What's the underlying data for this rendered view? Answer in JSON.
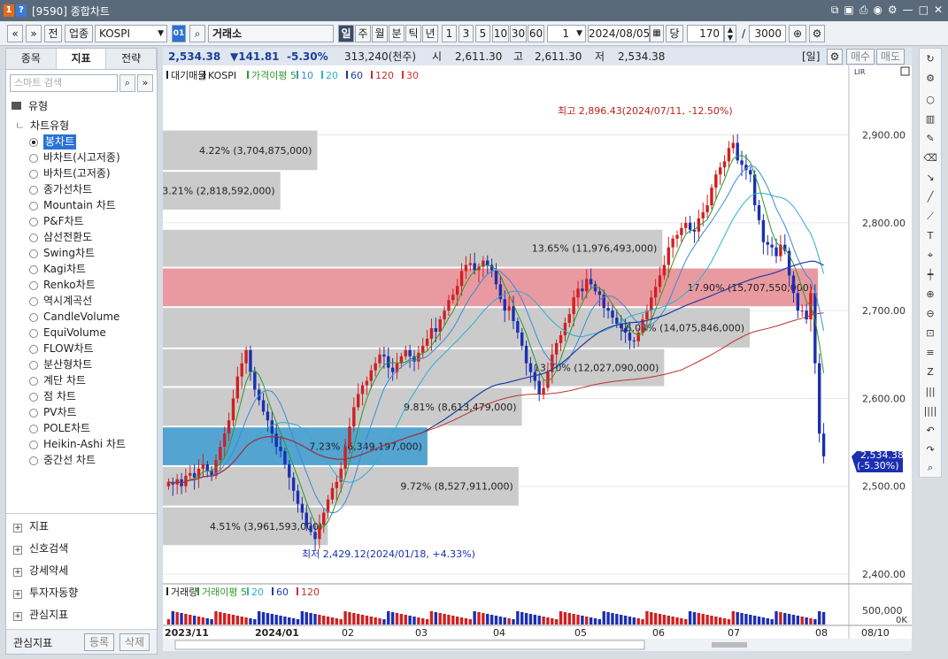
{
  "window": {
    "badge1": "1",
    "badge2": "?",
    "title": "[9590] 종합차트"
  },
  "toolbar": {
    "nav_prev": "«",
    "nav_down": "»",
    "jeon": "전",
    "category": "업종",
    "code": "KOSPI",
    "code_btn": "01",
    "market": "거래소",
    "periods": [
      "일",
      "주",
      "월",
      "분",
      "틱",
      "년"
    ],
    "intervals": [
      "1",
      "3",
      "5",
      "10",
      "30",
      "60"
    ],
    "count": "1",
    "date": "2024/08/05",
    "unit": "당",
    "bars": "170",
    "slash": "/",
    "max": "3000"
  },
  "left_panel": {
    "tabs": [
      "종목",
      "지표",
      "전략"
    ],
    "search_placeholder": "스마트 검색",
    "group": "유형",
    "subgroup": "차트유형",
    "chart_types": [
      "봉차트",
      "바차트(시고저종)",
      "바차트(고저종)",
      "종가선차트",
      "Mountain 차트",
      "P&F차트",
      "삼선전환도",
      "Swing차트",
      "Kagi차트",
      "Renko차트",
      "역시계곡선",
      "CandleVolume",
      "EquiVolume",
      "FLOW차트",
      "분산형차트",
      "계단 차트",
      "점 차트",
      "PV차트",
      "POLE차트",
      "Heikin-Ashi 차트",
      "중간선 차트"
    ],
    "bottom_groups": [
      "지표",
      "신호검색",
      "강세약세",
      "투자자동향",
      "관심지표"
    ],
    "footer": {
      "label": "관심지표",
      "register": "등록",
      "delete": "삭제"
    }
  },
  "price_bar": {
    "last": "2,534.38",
    "change": "▼141.81",
    "pct": "-5.30%",
    "volume": "313,240(천주)",
    "open_l": "시",
    "open": "2,611.30",
    "high_l": "고",
    "high": "2,611.30",
    "low_l": "저",
    "low": "2,534.38",
    "period": "[일]",
    "buy": "매수",
    "sell": "매도"
  },
  "legend": {
    "items": [
      "대기매물",
      "KOSPI",
      "가격이평 5",
      "10",
      "20",
      "60",
      "120",
      "30"
    ],
    "colors": [
      "#222",
      "#222",
      "#2c9a2c",
      "#3a8bd6",
      "#2bb0d0",
      "#1f3d9e",
      "#c03030",
      "#d33"
    ]
  },
  "volume_legend": {
    "items": [
      "거래량",
      "거래이평 5",
      "20",
      "60",
      "120"
    ],
    "colors": [
      "#222",
      "#2c9a2c",
      "#2bb0d0",
      "#1f3d9e",
      "#c03030"
    ]
  },
  "chart_data": {
    "type": "candlestick",
    "y_ticks": [
      "2,900.00",
      "2,800.00",
      "2,700.00",
      "2,600.00",
      "2,500.00",
      "2,400.00"
    ],
    "ylim": [
      2395,
      2965
    ],
    "x_ticks": [
      "2023/11",
      "2024/01",
      "02",
      "03",
      "04",
      "05",
      "06",
      "07",
      "08",
      "08/10"
    ],
    "annotations": {
      "high": "최고 2,896.43(2024/07/11, -12.50%)",
      "low": "최저 2,429.12(2024/01/18, +4.33%)"
    },
    "current_label": [
      "2,534.38",
      "(-5.30%)"
    ],
    "volume_profile": [
      {
        "label": "4.22% (3,704,875,000)",
        "low": 2860,
        "high": 2905,
        "fraction": 0.0422
      },
      {
        "label": "3.21% (2,818,592,000)",
        "low": 2815,
        "high": 2858,
        "fraction": 0.0321
      },
      {
        "label": "13.65% (11,976,493,000)",
        "low": 2750,
        "high": 2792,
        "fraction": 0.1365
      },
      {
        "label": "17.90% (15,707,550,000)",
        "low": 2705,
        "high": 2748,
        "fraction": 0.179
      },
      {
        "label": "16.04% (14,075,846,000)",
        "low": 2658,
        "high": 2703,
        "fraction": 0.1604
      },
      {
        "label": "13.70% (12,027,090,000)",
        "low": 2614,
        "high": 2656,
        "fraction": 0.137
      },
      {
        "label": "9.81% (8,613,479,000)",
        "low": 2569,
        "high": 2612,
        "fraction": 0.0981
      },
      {
        "label": "7.23% (6,349,197,000)",
        "low": 2524,
        "high": 2567,
        "fraction": 0.0723
      },
      {
        "label": "9.72% (8,527,911,000)",
        "low": 2478,
        "high": 2522,
        "fraction": 0.0972
      },
      {
        "label": "4.51% (3,961,593,000)",
        "low": 2433,
        "high": 2476,
        "fraction": 0.0451
      }
    ],
    "closes": [
      2505,
      2502,
      2508,
      2500,
      2512,
      2515,
      2510,
      2520,
      2525,
      2518,
      2512,
      2530,
      2545,
      2560,
      2575,
      2600,
      2625,
      2640,
      2655,
      2630,
      2610,
      2598,
      2585,
      2575,
      2560,
      2545,
      2540,
      2525,
      2510,
      2495,
      2480,
      2470,
      2455,
      2448,
      2440,
      2456,
      2470,
      2485,
      2498,
      2505,
      2520,
      2545,
      2568,
      2590,
      2605,
      2615,
      2620,
      2632,
      2640,
      2650,
      2648,
      2635,
      2630,
      2640,
      2648,
      2655,
      2648,
      2642,
      2652,
      2660,
      2668,
      2680,
      2676,
      2690,
      2700,
      2712,
      2718,
      2728,
      2745,
      2752,
      2754,
      2746,
      2750,
      2757,
      2752,
      2746,
      2730,
      2713,
      2700,
      2705,
      2688,
      2675,
      2660,
      2640,
      2630,
      2620,
      2605,
      2612,
      2630,
      2650,
      2663,
      2672,
      2686,
      2696,
      2715,
      2725,
      2722,
      2736,
      2730,
      2722,
      2718,
      2703,
      2700,
      2692,
      2685,
      2680,
      2675,
      2666,
      2665,
      2675,
      2690,
      2700,
      2715,
      2727,
      2740,
      2752,
      2772,
      2782,
      2786,
      2794,
      2800,
      2792,
      2790,
      2805,
      2812,
      2820,
      2840,
      2855,
      2863,
      2870,
      2885,
      2891,
      2871,
      2866,
      2860,
      2855,
      2820,
      2803,
      2778,
      2775,
      2772,
      2762,
      2775,
      2768,
      2740,
      2720,
      2700,
      2700,
      2690,
      2720,
      2640,
      2560,
      2534
    ],
    "volume_ylabels": [
      "500,000",
      "0K"
    ]
  }
}
